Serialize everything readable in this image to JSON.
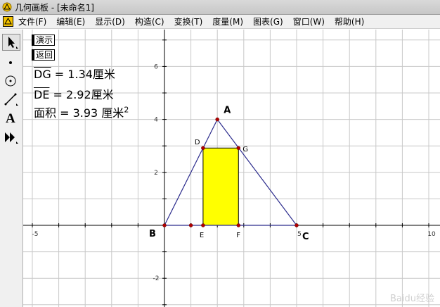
{
  "window": {
    "title": "几何画板 - [未命名1]"
  },
  "menu": [
    "文件(F)",
    "编辑(E)",
    "显示(D)",
    "构造(C)",
    "变换(T)",
    "度量(M)",
    "图表(G)",
    "窗口(W)",
    "帮助(H)"
  ],
  "buttons": {
    "demo": "演示",
    "back": "返回"
  },
  "measurements": [
    {
      "label": "DG",
      "value": " = 1.34厘米",
      "overline": true
    },
    {
      "label": "DE",
      "value": " = 2.92厘米",
      "overline": true
    },
    {
      "label": "面积",
      "value": " = 3.93 厘米",
      "overline": false,
      "sup": "2"
    }
  ],
  "axes": {
    "x_ticks": [
      {
        "v": -5,
        "label": "-5"
      },
      {
        "v": 5,
        "label": "5"
      },
      {
        "v": 10,
        "label": "10"
      }
    ],
    "y_ticks": [
      {
        "v": 6,
        "label": "6"
      },
      {
        "v": 4,
        "label": "4"
      },
      {
        "v": 2,
        "label": "2"
      },
      {
        "v": -2,
        "label": "-2"
      }
    ]
  },
  "points": [
    {
      "name": "A",
      "x": 2,
      "y": 4
    },
    {
      "name": "B",
      "x": 0,
      "y": 0
    },
    {
      "name": "C",
      "x": 5,
      "y": 0
    },
    {
      "name": "D",
      "x": 1.46,
      "y": 2.92
    },
    {
      "name": "G",
      "x": 2.8,
      "y": 2.92
    },
    {
      "name": "E",
      "x": 1.46,
      "y": 0
    },
    {
      "name": "F",
      "x": 2.8,
      "y": 0
    },
    {
      "name": "",
      "x": 1,
      "y": 0
    }
  ],
  "colors": {
    "fill": "#ffff00",
    "line": "#2b2b8c",
    "grid": "#c8c8c8",
    "point": "#b00000"
  },
  "watermark": "Baidu经验"
}
